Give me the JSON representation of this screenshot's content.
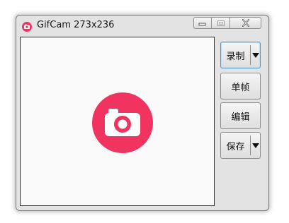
{
  "window": {
    "title": "GifCam 273x236",
    "icon": "camera-icon",
    "caption_buttons": [
      "minimize",
      "maximize",
      "close"
    ]
  },
  "preview": {
    "logo": "camera-icon",
    "logo_color": "#f0345f"
  },
  "buttons": {
    "record": "录制",
    "frame": "单帧",
    "edit": "编辑",
    "save": "保存"
  },
  "colors": {
    "accent": "#f0345f",
    "focus_border": "#4a9ad6"
  }
}
